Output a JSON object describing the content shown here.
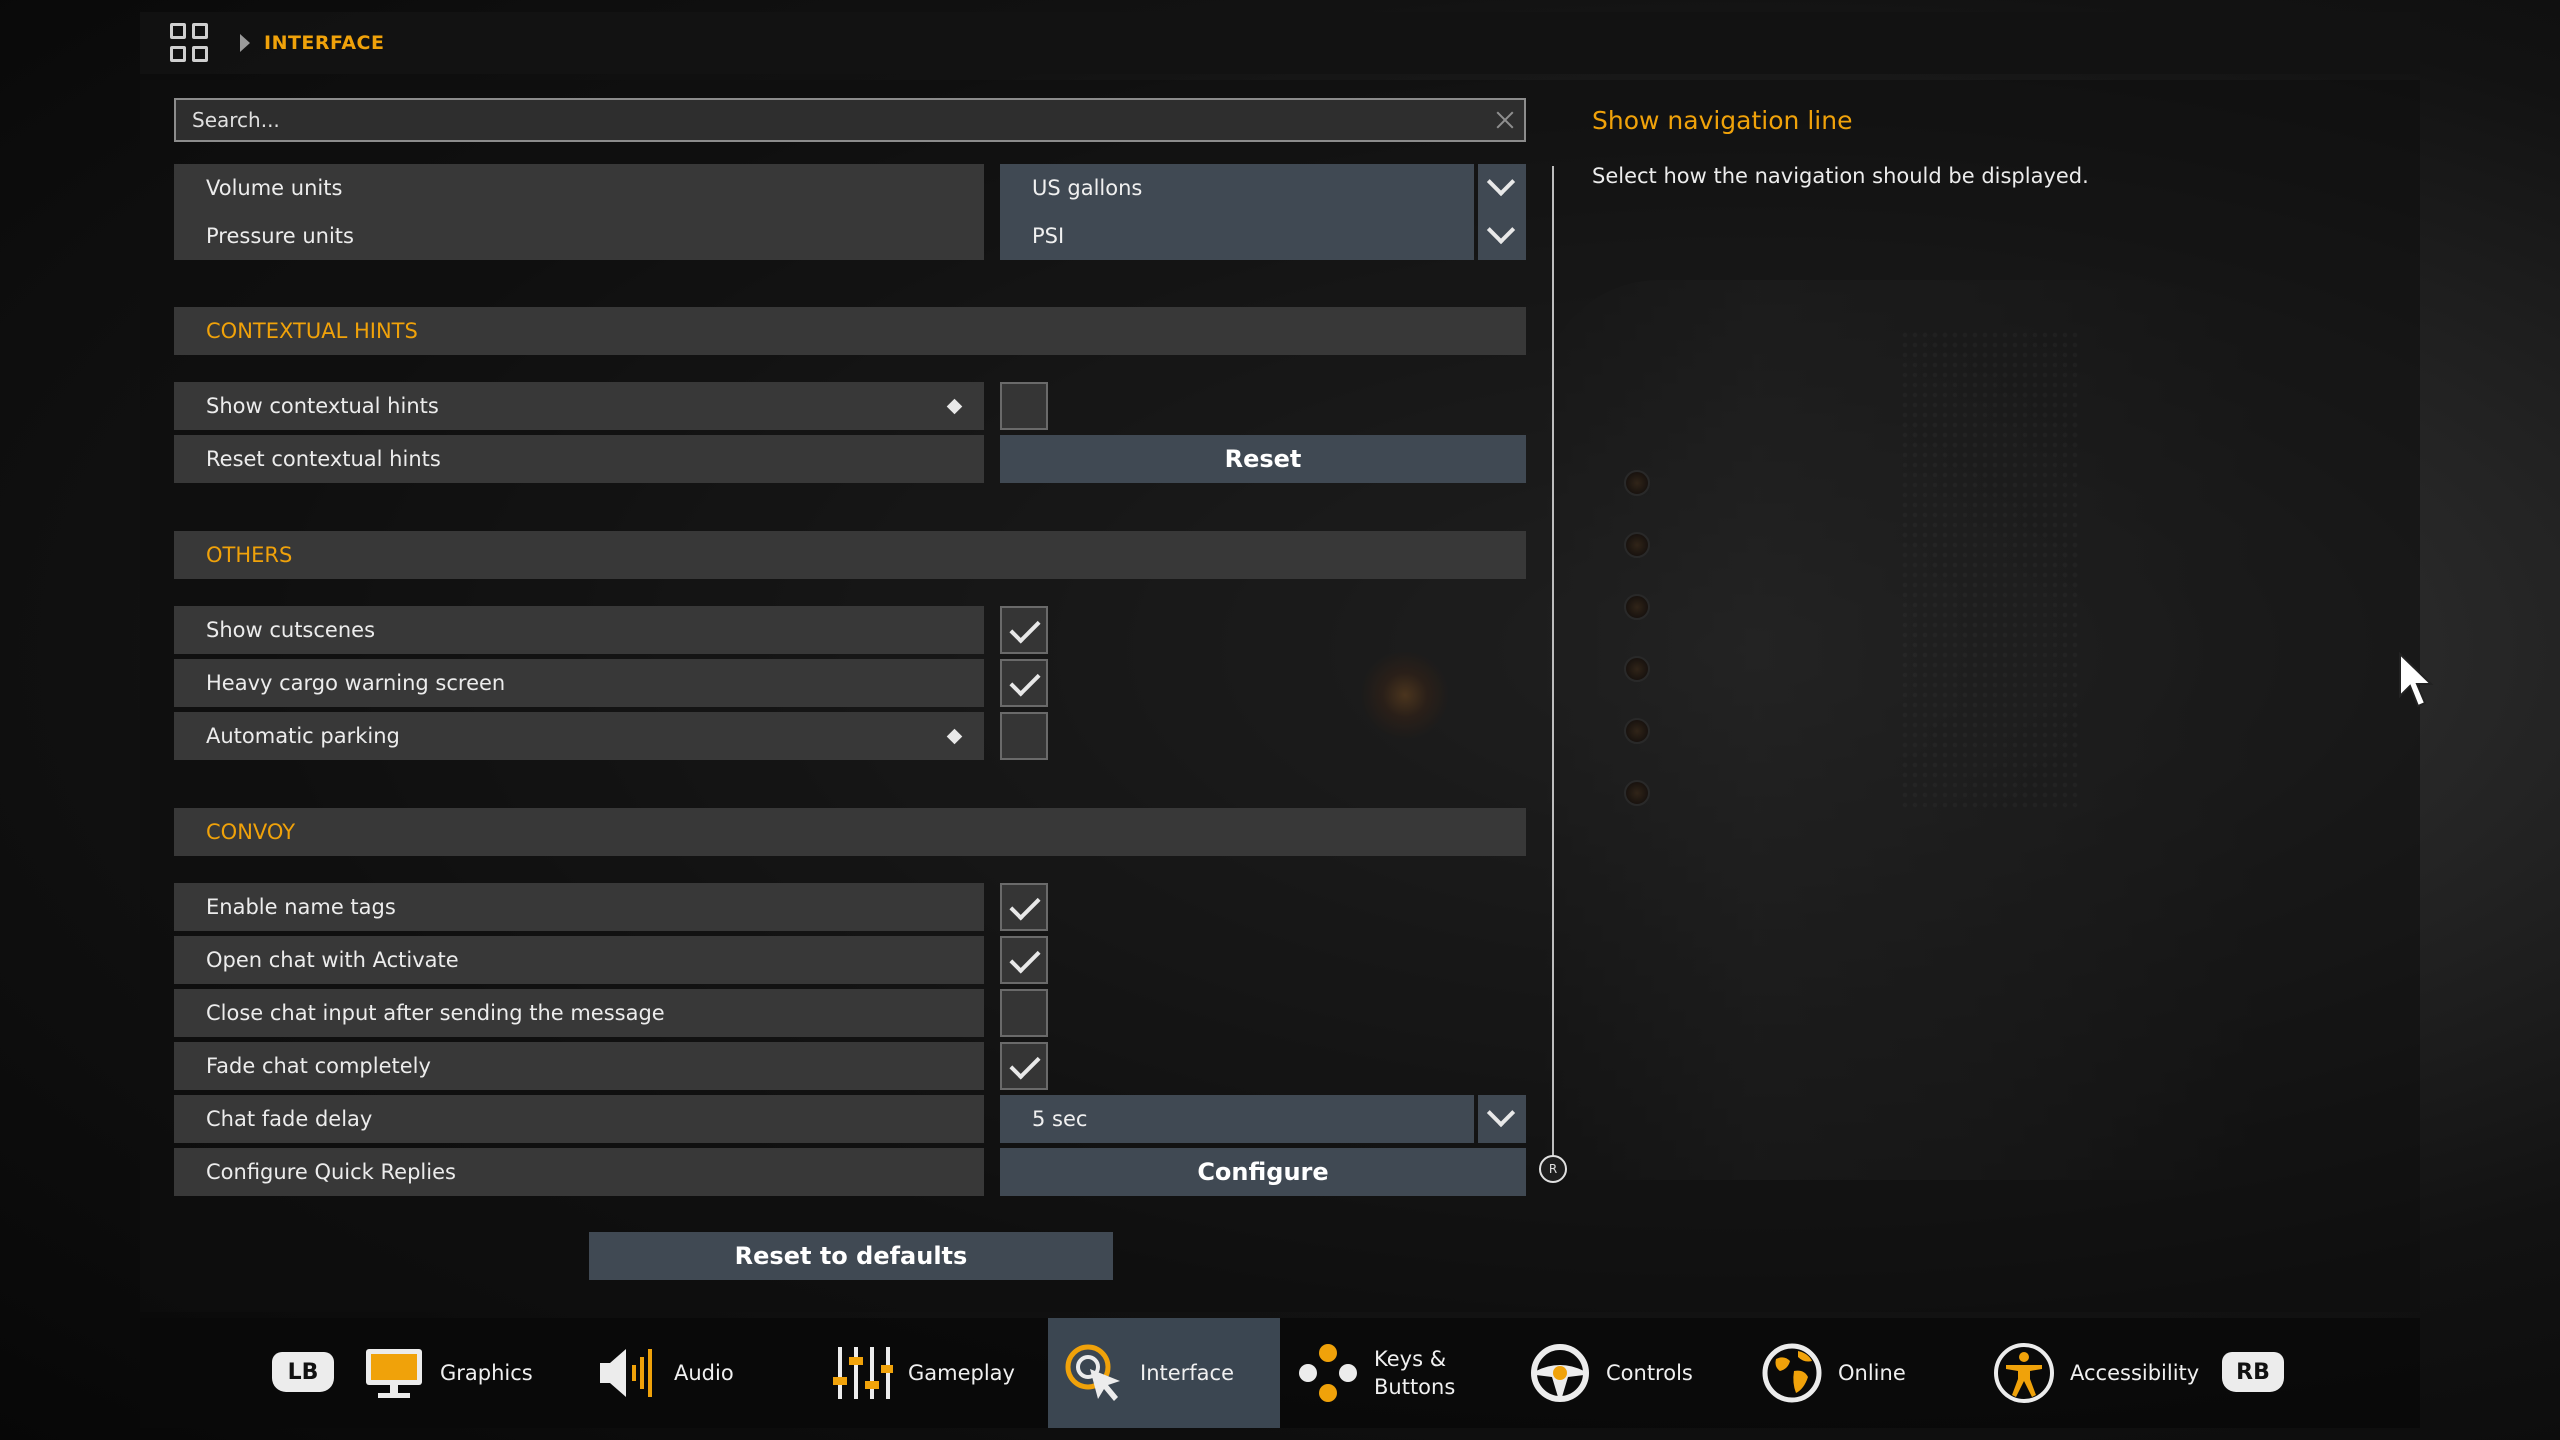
{
  "breadcrumb": {
    "icon": "grid-menu-icon",
    "current": "INTERFACE"
  },
  "search": {
    "placeholder": "Search..."
  },
  "settings": {
    "volume_units": {
      "label": "Volume units",
      "value": "US gallons"
    },
    "pressure_units": {
      "label": "Pressure units",
      "value": "PSI"
    },
    "contextual_hints": {
      "header": "CONTEXTUAL HINTS",
      "show": {
        "label": "Show contextual hints",
        "checked": false
      },
      "reset": {
        "label": "Reset contextual hints",
        "button": "Reset"
      }
    },
    "others": {
      "header": "OTHERS",
      "show_cutscenes": {
        "label": "Show cutscenes",
        "checked": true
      },
      "heavy_cargo": {
        "label": "Heavy cargo warning screen",
        "checked": true
      },
      "automatic_parking": {
        "label": "Automatic parking",
        "checked": false
      }
    },
    "convoy": {
      "header": "CONVOY",
      "name_tags": {
        "label": "Enable name tags",
        "checked": true
      },
      "open_chat": {
        "label": "Open chat with Activate",
        "checked": true
      },
      "close_chat": {
        "label": "Close chat input after sending the message",
        "checked": false
      },
      "fade_chat": {
        "label": "Fade chat completely",
        "checked": true
      },
      "chat_fade_delay": {
        "label": "Chat fade delay",
        "value": "5 sec"
      },
      "quick_replies": {
        "label": "Configure Quick Replies",
        "button": "Configure"
      }
    }
  },
  "reset_defaults": "Reset to defaults",
  "scrollbar": {
    "thumb_glyph": "R"
  },
  "description": {
    "title": "Show navigation line",
    "text": "Select how the navigation should be displayed."
  },
  "bottom_nav": {
    "left_bumper": "LB",
    "right_bumper": "RB",
    "tabs": [
      {
        "label": "Graphics",
        "icon": "monitor-icon",
        "active": false
      },
      {
        "label": "Audio",
        "icon": "speaker-icon",
        "active": false
      },
      {
        "label": "Gameplay",
        "icon": "sliders-icon",
        "active": false
      },
      {
        "label": "Interface",
        "icon": "cursor-click-icon",
        "active": true
      },
      {
        "label": "Keys &\nButtons",
        "icon": "gamepad-buttons-icon",
        "active": false
      },
      {
        "label": "Controls",
        "icon": "steering-wheel-icon",
        "active": false
      },
      {
        "label": "Online",
        "icon": "globe-icon",
        "active": false
      },
      {
        "label": "Accessibility",
        "icon": "accessibility-icon",
        "active": false
      }
    ]
  },
  "colors": {
    "accent": "#f0a20a",
    "control_bg": "#404953",
    "row_bg": "#383838",
    "active_tab": "#3b4651"
  }
}
